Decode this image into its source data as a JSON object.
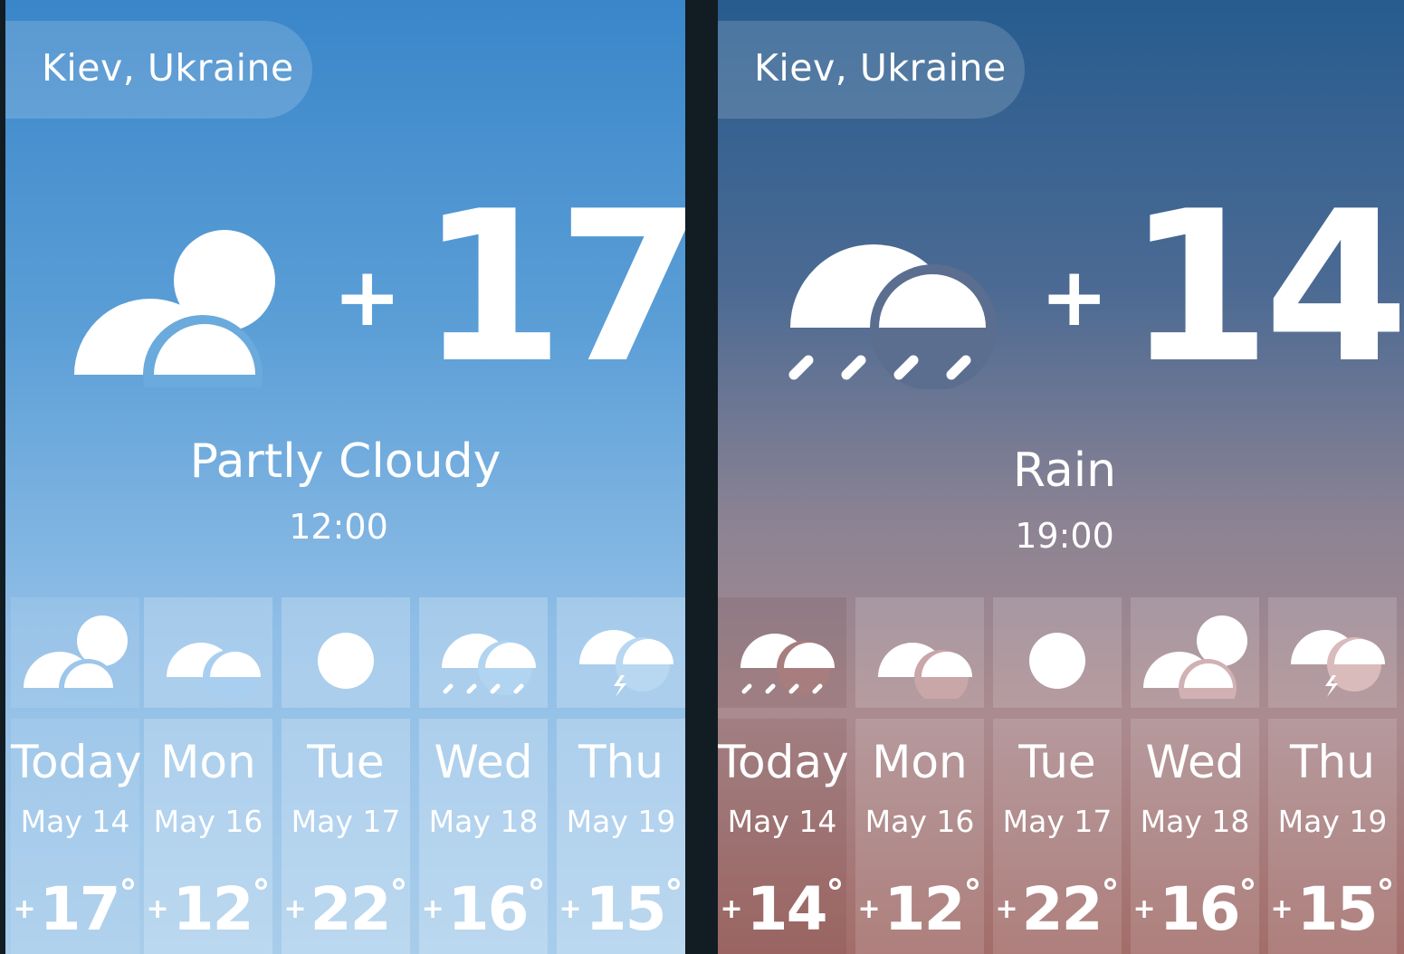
{
  "panels": [
    {
      "location": "Kiev, Ukraine",
      "current": {
        "sign": "+",
        "temp": "17",
        "degree": "°",
        "condition": "Partly Cloudy",
        "time": "12:00",
        "icon": "partly-cloudy-icon"
      },
      "theme": "day",
      "forecast": [
        {
          "day": "Today",
          "date": "May 14",
          "sign": "+",
          "temp": "17",
          "degree": "°",
          "icon": "partly-cloudy-icon"
        },
        {
          "day": "Mon",
          "date": "May 16",
          "sign": "+",
          "temp": "12",
          "degree": "°",
          "icon": "cloudy-icon"
        },
        {
          "day": "Tue",
          "date": "May 17",
          "sign": "+",
          "temp": "22",
          "degree": "°",
          "icon": "sun-icon"
        },
        {
          "day": "Wed",
          "date": "May 18",
          "sign": "+",
          "temp": "16",
          "degree": "°",
          "icon": "rain-icon"
        },
        {
          "day": "Thu",
          "date": "May 19",
          "sign": "+",
          "temp": "15",
          "degree": "°",
          "icon": "thunderstorm-icon"
        }
      ]
    },
    {
      "location": "Kiev, Ukraine",
      "current": {
        "sign": "+",
        "temp": "14",
        "degree": "°",
        "condition": "Rain",
        "time": "19:00",
        "icon": "rain-icon"
      },
      "theme": "evening",
      "forecast": [
        {
          "day": "Today",
          "date": "May 14",
          "sign": "+",
          "temp": "14",
          "degree": "°",
          "icon": "rain-icon"
        },
        {
          "day": "Mon",
          "date": "May 16",
          "sign": "+",
          "temp": "12",
          "degree": "°",
          "icon": "cloudy-icon"
        },
        {
          "day": "Tue",
          "date": "May 17",
          "sign": "+",
          "temp": "22",
          "degree": "°",
          "icon": "sun-icon"
        },
        {
          "day": "Wed",
          "date": "May 18",
          "sign": "+",
          "temp": "16",
          "degree": "°",
          "icon": "partly-cloudy-icon"
        },
        {
          "day": "Thu",
          "date": "May 19",
          "sign": "+",
          "temp": "15",
          "degree": "°",
          "icon": "thunderstorm-icon"
        }
      ]
    }
  ],
  "colors": {
    "day_top": "#3a86c9",
    "day_bottom": "#a8cdeb",
    "evening_top": "#275c8f",
    "evening_bottom": "#a36d69",
    "divider": "#121c23"
  }
}
